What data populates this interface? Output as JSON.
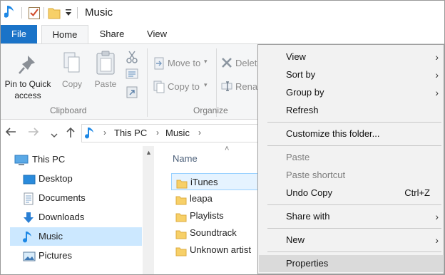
{
  "window": {
    "title": "Music"
  },
  "quick_access_toolbar": {
    "icons": [
      "music-note-icon",
      "properties-check-icon",
      "new-folder-icon",
      "customize-dropdown-icon"
    ]
  },
  "ribbon_tabs": [
    {
      "label": "File",
      "active": false
    },
    {
      "label": "Home",
      "active": true
    },
    {
      "label": "Share",
      "active": false
    },
    {
      "label": "View",
      "active": false
    }
  ],
  "ribbon": {
    "clipboard": {
      "pin_label_line1": "Pin to Quick",
      "pin_label_line2": "access",
      "copy_label": "Copy",
      "paste_label": "Paste",
      "group_label": "Clipboard"
    },
    "organize": {
      "move_to_label": "Move to",
      "copy_to_label": "Copy to",
      "delete_label": "Delet",
      "rename_label": "Rena",
      "group_label": "Organize"
    }
  },
  "address_bar": {
    "crumbs": [
      "This PC",
      "Music"
    ]
  },
  "nav_pane": {
    "items": [
      {
        "label": "This PC",
        "icon": "computer-icon",
        "selected": false
      },
      {
        "label": "Desktop",
        "icon": "desktop-icon",
        "selected": false
      },
      {
        "label": "Documents",
        "icon": "documents-icon",
        "selected": false
      },
      {
        "label": "Downloads",
        "icon": "download-arrow-icon",
        "selected": false
      },
      {
        "label": "Music",
        "icon": "music-note-icon",
        "selected": true
      },
      {
        "label": "Pictures",
        "icon": "pictures-icon",
        "selected": false
      }
    ]
  },
  "file_list": {
    "column_name": "Name",
    "items": [
      {
        "name": "iTunes",
        "highlighted": true
      },
      {
        "name": "leapa",
        "highlighted": false
      },
      {
        "name": "Playlists",
        "highlighted": false
      },
      {
        "name": "Soundtrack",
        "highlighted": false
      },
      {
        "name": "Unknown artist",
        "highlighted": false
      }
    ]
  },
  "context_menu": {
    "items": [
      {
        "label": "View",
        "submenu": true,
        "disabled": false
      },
      {
        "label": "Sort by",
        "submenu": true,
        "disabled": false
      },
      {
        "label": "Group by",
        "submenu": true,
        "disabled": false
      },
      {
        "label": "Refresh",
        "submenu": false,
        "disabled": false
      },
      {
        "label": "Customize this folder...",
        "submenu": false,
        "disabled": false
      },
      {
        "label": "Paste",
        "submenu": false,
        "disabled": true
      },
      {
        "label": "Paste shortcut",
        "submenu": false,
        "disabled": true
      },
      {
        "label": "Undo Copy",
        "shortcut": "Ctrl+Z",
        "submenu": false,
        "disabled": false
      },
      {
        "label": "Share with",
        "submenu": true,
        "disabled": false
      },
      {
        "label": "New",
        "submenu": true,
        "disabled": false
      },
      {
        "label": "Properties",
        "submenu": false,
        "disabled": false,
        "highlighted": true
      }
    ]
  },
  "colors": {
    "file_tab": "#1a73c8",
    "selection": "#cce8ff",
    "folder": "#f7d068",
    "music_note": "#1e88e5"
  }
}
